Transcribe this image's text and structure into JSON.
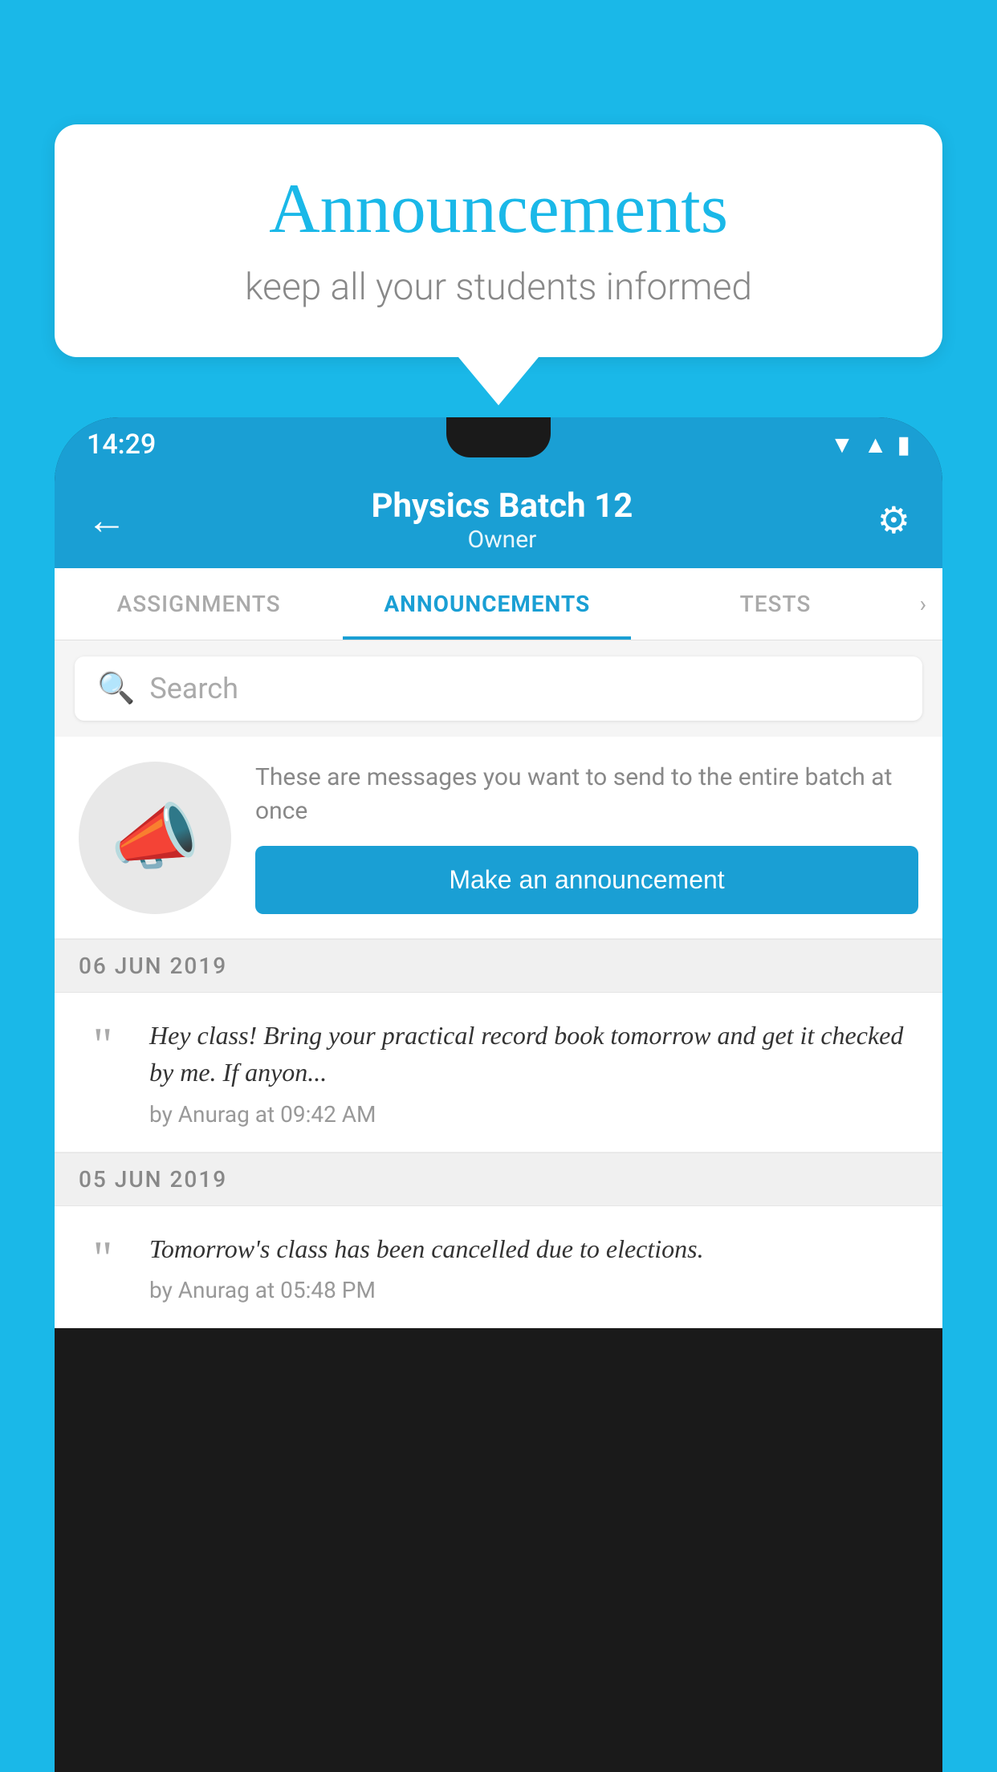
{
  "background_color": "#1ab8e8",
  "speech_bubble": {
    "title": "Announcements",
    "subtitle": "keep all your students informed"
  },
  "status_bar": {
    "time": "14:29",
    "wifi": "▲",
    "signal": "▲",
    "battery": "▮"
  },
  "app_bar": {
    "back_label": "←",
    "title": "Physics Batch 12",
    "subtitle": "Owner",
    "settings_label": "⚙"
  },
  "tabs": [
    {
      "label": "ASSIGNMENTS",
      "active": false
    },
    {
      "label": "ANNOUNCEMENTS",
      "active": true
    },
    {
      "label": "TESTS",
      "active": false
    },
    {
      "label": "›",
      "active": false
    }
  ],
  "search": {
    "placeholder": "Search",
    "icon": "🔍"
  },
  "announcement_prompt": {
    "description": "These are messages you want to send to the entire batch at once",
    "button_label": "Make an announcement"
  },
  "announcement_sections": [
    {
      "date": "06  JUN  2019",
      "items": [
        {
          "text": "Hey class! Bring your practical record book tomorrow and get it checked by me. If anyon...",
          "meta": "by Anurag at 09:42 AM"
        }
      ]
    },
    {
      "date": "05  JUN  2019",
      "items": [
        {
          "text": "Tomorrow's class has been cancelled due to elections.",
          "meta": "by Anurag at 05:48 PM"
        }
      ]
    }
  ]
}
